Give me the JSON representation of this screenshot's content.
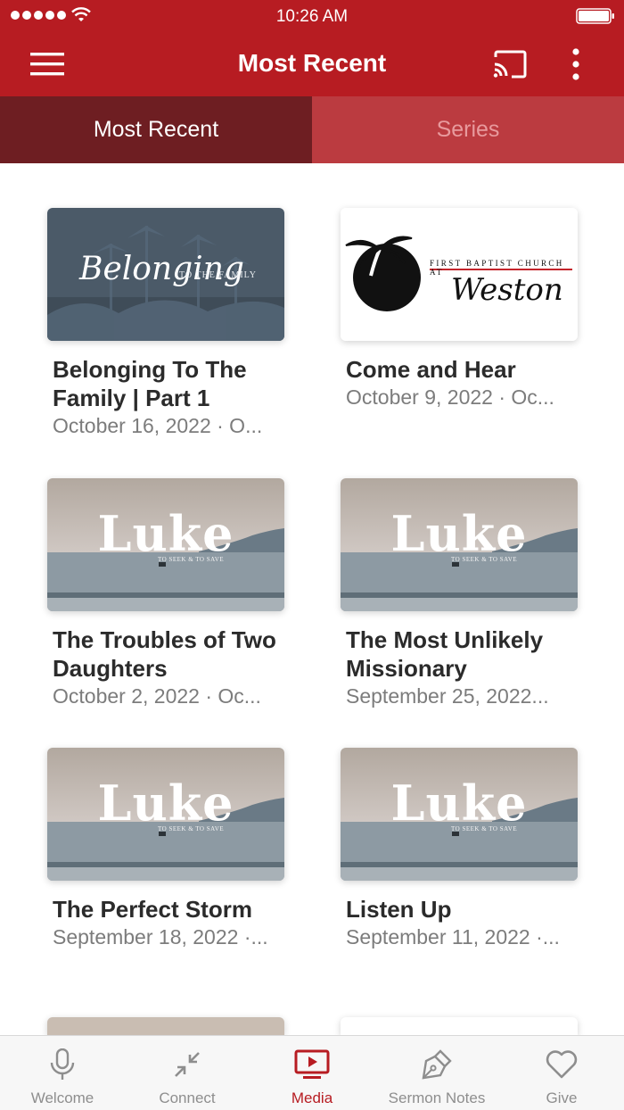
{
  "status_bar": {
    "time": "10:26 AM"
  },
  "header": {
    "title": "Most Recent",
    "menu_icon": "hamburger-menu-icon",
    "cast_icon": "cast-icon",
    "more_icon": "more-vertical-icon"
  },
  "tabs": [
    {
      "label": "Most Recent",
      "active": true
    },
    {
      "label": "Series",
      "active": false
    }
  ],
  "sermons": [
    {
      "title": "Belonging To The Family | Part 1",
      "date": "October 16, 2022 · O...",
      "thumbnail": {
        "type": "belonging",
        "word": "Belonging",
        "sub": "TO THE FAMILY"
      }
    },
    {
      "title": "Come and Hear",
      "date": "October 9, 2022 · Oc...",
      "thumbnail": {
        "type": "church-logo",
        "line": "FIRST BAPTIST CHURCH AT",
        "name": "Weston"
      }
    },
    {
      "title": "The Troubles of Two Daughters",
      "date": "October 2, 2022 · Oc...",
      "thumbnail": {
        "type": "luke",
        "word": "Luke",
        "sub": "TO SEEK & TO SAVE"
      }
    },
    {
      "title": "The Most Unlikely Missionary",
      "date": "September 25, 2022...",
      "thumbnail": {
        "type": "luke",
        "word": "Luke",
        "sub": "TO SEEK & TO SAVE"
      }
    },
    {
      "title": "The Perfect Storm",
      "date": "September 18, 2022 ·...",
      "thumbnail": {
        "type": "luke",
        "word": "Luke",
        "sub": "TO SEEK & TO SAVE"
      }
    },
    {
      "title": "Listen Up",
      "date": "September 11, 2022 ·...",
      "thumbnail": {
        "type": "luke",
        "word": "Luke",
        "sub": "TO SEEK & TO SAVE"
      }
    }
  ],
  "tab_bar": [
    {
      "label": "Welcome",
      "icon": "microphone-icon",
      "active": false
    },
    {
      "label": "Connect",
      "icon": "connect-arrows-icon",
      "active": false
    },
    {
      "label": "Media",
      "icon": "tv-play-icon",
      "active": true
    },
    {
      "label": "Sermon Notes",
      "icon": "pen-nib-icon",
      "active": false
    },
    {
      "label": "Give",
      "icon": "heart-icon",
      "active": false
    }
  ],
  "colors": {
    "brand": "#b71c22",
    "tab_active": "#6e1e22",
    "tab_inactive": "#bb3b40"
  }
}
